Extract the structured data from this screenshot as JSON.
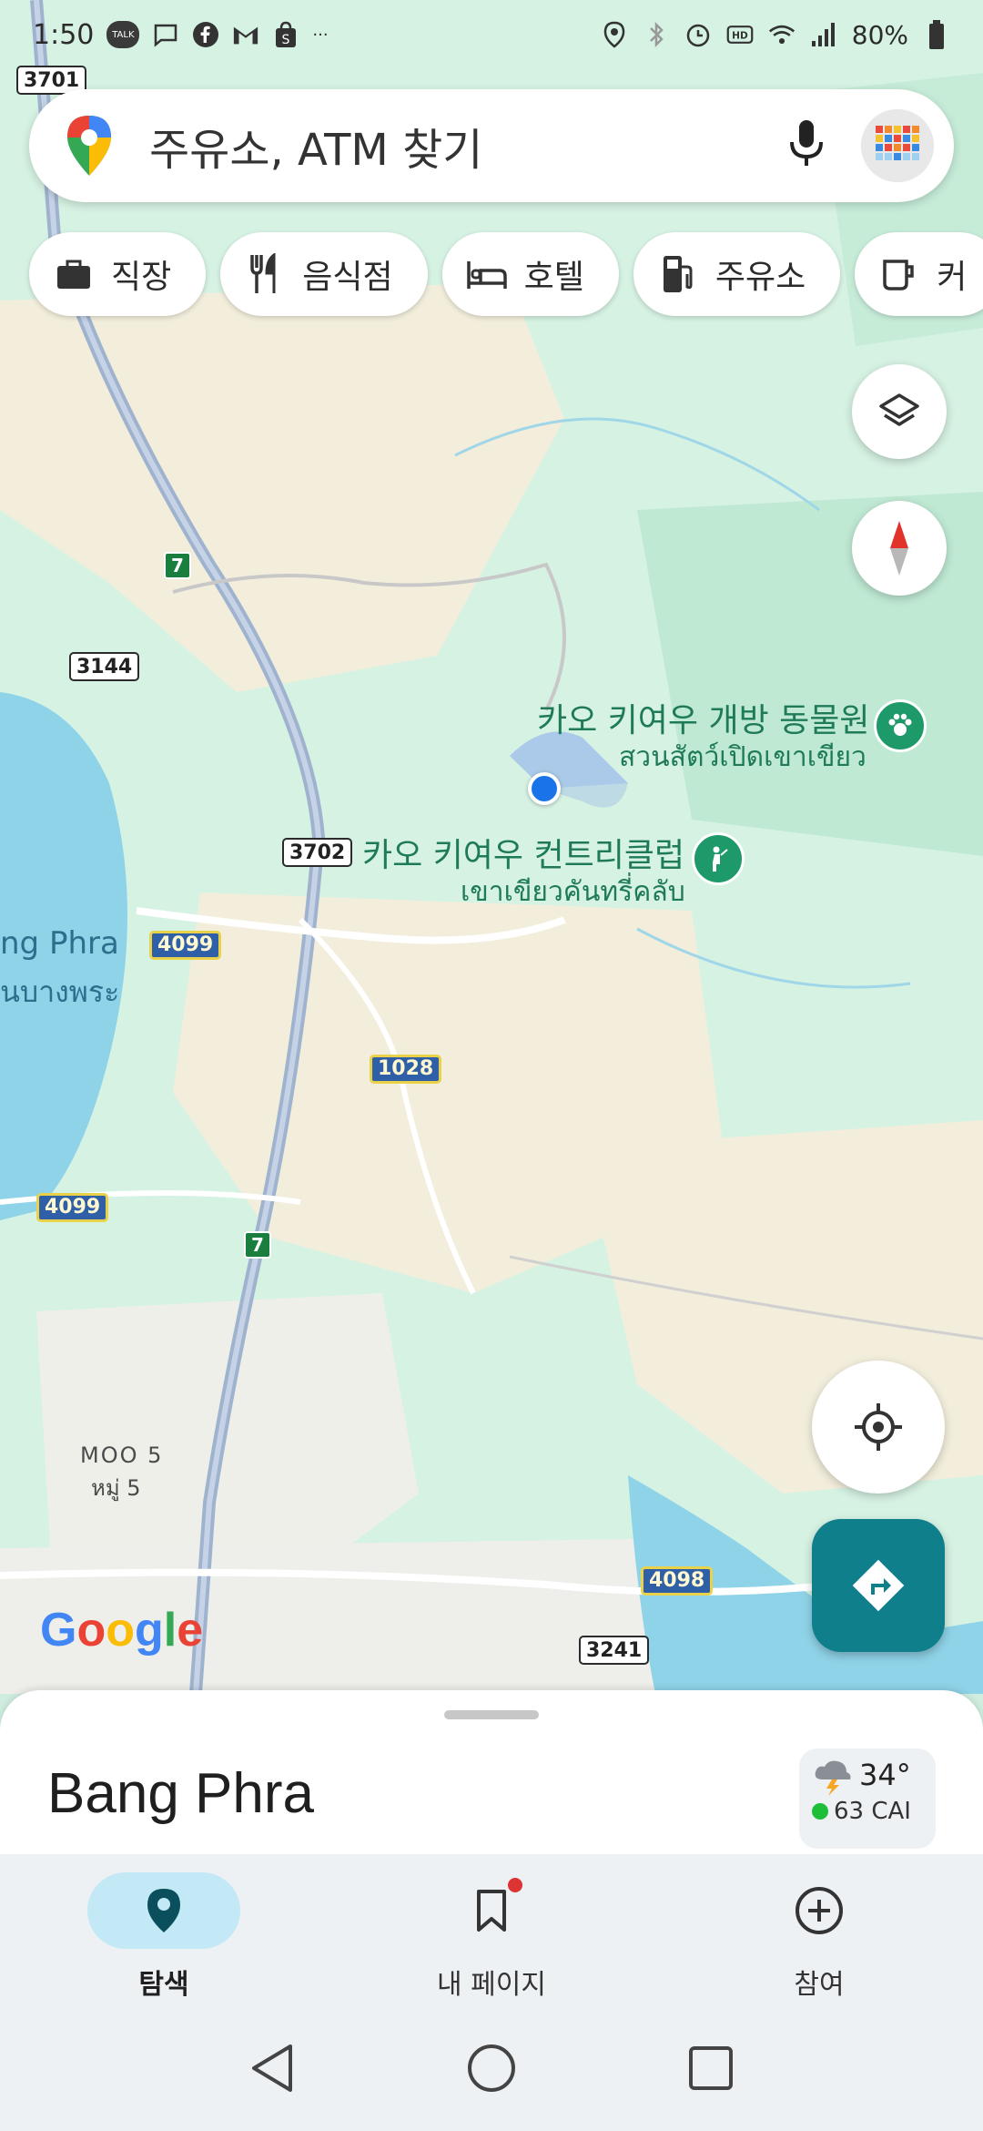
{
  "status_bar": {
    "time": "1:50",
    "battery": "80%",
    "more": "···",
    "notif_talk": "TALK"
  },
  "search": {
    "placeholder": "주유소, ATM 찾기"
  },
  "chips": [
    {
      "label": "직장",
      "icon": "briefcase-icon"
    },
    {
      "label": "음식점",
      "icon": "fork-knife-icon"
    },
    {
      "label": "호텔",
      "icon": "bed-icon"
    },
    {
      "label": "주유소",
      "icon": "gas-pump-icon"
    },
    {
      "label": "커",
      "icon": "coffee-icon"
    }
  ],
  "map": {
    "poi_zoo": {
      "name": "카오 키여우 개방 동물원",
      "name_th": "สวนสัตว์เปิดเขาเขียว"
    },
    "poi_golf": {
      "name": "카오 키여우 컨트리클럽",
      "name_th": "เขาเขียวคันทรี่คลับ"
    },
    "lake": {
      "name": "ng Phra",
      "name_th": "นบางพระ"
    },
    "village": {
      "name": "MOO 5",
      "name_th": "หมู่ 5"
    },
    "roads": [
      "3701",
      "3144",
      "3702",
      "4099",
      "1028",
      "4099",
      "4098",
      "3241"
    ],
    "exit_label": "7",
    "attribution": "Google"
  },
  "sheet": {
    "place": "Bang Phra",
    "temperature": "34°",
    "air_quality": "63 CAI"
  },
  "nav": {
    "explore": "탐색",
    "my_page": "내 페이지",
    "contribute": "참여"
  },
  "colors": {
    "accent": "#0f7f8c",
    "nav_active": "#c2e9f5",
    "poi_green": "#1e9a6a",
    "location_blue": "#1a73e8"
  }
}
